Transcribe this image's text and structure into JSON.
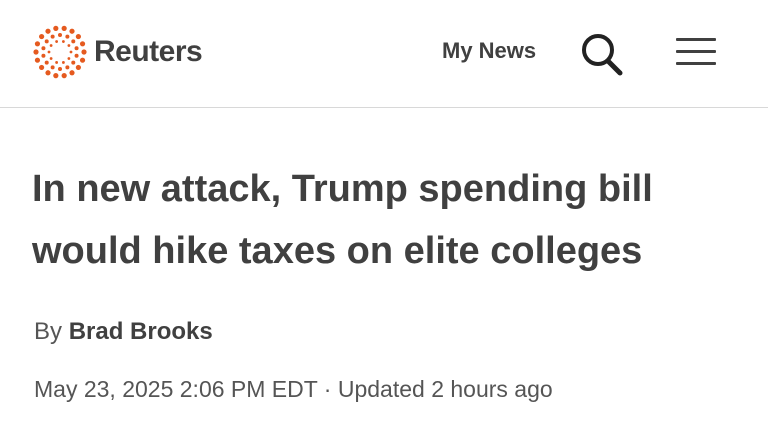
{
  "header": {
    "logo_text": "Reuters",
    "logo_color": "#e55a1f",
    "my_news_label": "My News",
    "search_icon": "search-icon",
    "menu_icon": "hamburger-menu-icon"
  },
  "article": {
    "headline": "In new attack, Trump spending bill would hike taxes on elite colleges",
    "byline_prefix": "By",
    "author": "Brad Brooks",
    "published": "May 23, 2025 2:06 PM EDT",
    "separator": "·",
    "updated": "Updated 2 hours ago"
  }
}
